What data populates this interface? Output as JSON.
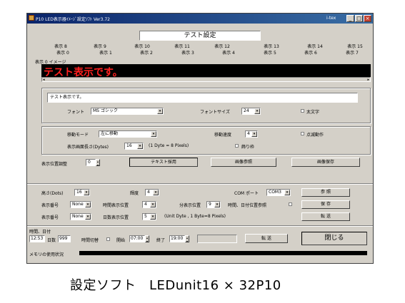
{
  "window": {
    "title": "P10 LED表示器ｲﾒｰｼﾞ設定ｿﾌﾄ Ver3.72",
    "brand": "i-tex"
  },
  "header_title": "テスト設定",
  "tabs_back": [
    "表示 8",
    "表示 9",
    "表示 10",
    "表示 11",
    "表示 12",
    "表示 13",
    "表示 14",
    "表示 15"
  ],
  "tabs_front": [
    "表示 0",
    "表示 1",
    "表示 2",
    "表示 3",
    "表示 4",
    "表示 5",
    "表示 6",
    "表示 7"
  ],
  "image_group_label": "表示 0 イメージ",
  "led_preview_text": "テスト表示です。",
  "text_input_value": "テスト表示です。",
  "font": {
    "label": "フォント",
    "value": "MS ゴシック",
    "size_label": "フォントサイズ",
    "size_value": "24",
    "bold_label": "太文字"
  },
  "move": {
    "mode_label": "移動モード",
    "mode_value": "左に移動",
    "speed_label": "移動速度",
    "speed_value": "4",
    "blink_label": "点滅動作"
  },
  "screen": {
    "length_label": "表示画面長さ(Dytes)",
    "length_value": "16",
    "note": "(1 Dyte = 8 Pixels)",
    "frame_label": "飾り枠"
  },
  "position": {
    "label": "表示位置調整",
    "value": "0"
  },
  "buttons": {
    "text_adopt": "テキスト採用",
    "image_ref": "画像参照",
    "image_save": "画像保存",
    "ref": "参 照",
    "save": "保 存",
    "send": "転 送",
    "send2": "転 送",
    "close": "閉じる"
  },
  "settings": {
    "height_label": "高さ(Dots)",
    "height_value": "16",
    "brightness_label": "輝度",
    "brightness_value": "4",
    "com_label": "COM ポート",
    "com_value": "COM3",
    "num1_label": "表示番号",
    "num1_value": "None",
    "time_pos_label": "時間表示位置",
    "time_pos_value": "4",
    "sec_pos_label": "分表示位置",
    "sec_pos_value": "9",
    "datetime_ref_label": "時間、日付位置参照",
    "num2_label": "表示番号",
    "num2_value": "None",
    "date_pos_label": "日数表示位置",
    "date_pos_value": "5",
    "unit_note": "(Unit Dyte , 1 Byte=8 Pixels)"
  },
  "datetime": {
    "label": "時間、日付",
    "time": "12:53",
    "days_label": "日数",
    "days_value": "999",
    "switch_label": "時間切替",
    "start_label": "開始",
    "start_value": "07:00",
    "end_label": "終了",
    "end_value": "19:00"
  },
  "memory_label": "メモリの使用状況",
  "caption": "設定ソフト　LEDunit16 × 32P10"
}
